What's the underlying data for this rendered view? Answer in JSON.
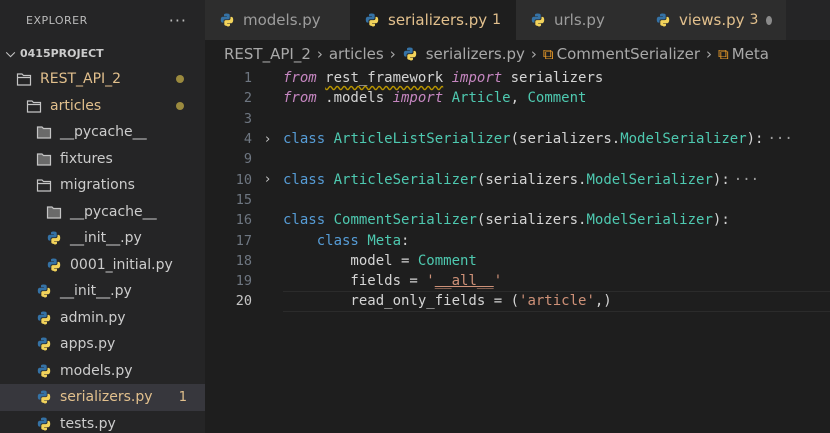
{
  "sidebar": {
    "header": "EXPLORER",
    "more": "···",
    "project": "0415PROJECT",
    "items": [
      {
        "label": "REST_API_2",
        "kind": "folder-open",
        "indent": 1,
        "modified": true,
        "dot": true
      },
      {
        "label": "articles",
        "kind": "folder-open",
        "indent": 2,
        "modified": true,
        "dot": true
      },
      {
        "label": "__pycache__",
        "kind": "folder",
        "indent": 3
      },
      {
        "label": "fixtures",
        "kind": "folder",
        "indent": 3
      },
      {
        "label": "migrations",
        "kind": "folder-open",
        "indent": 3
      },
      {
        "label": "__pycache__",
        "kind": "folder",
        "indent": 4
      },
      {
        "label": "__init__.py",
        "kind": "python",
        "indent": 4
      },
      {
        "label": "0001_initial.py",
        "kind": "python",
        "indent": 4
      },
      {
        "label": "__init__.py",
        "kind": "python",
        "indent": 3
      },
      {
        "label": "admin.py",
        "kind": "python",
        "indent": 3
      },
      {
        "label": "apps.py",
        "kind": "python",
        "indent": 3
      },
      {
        "label": "models.py",
        "kind": "python",
        "indent": 3
      },
      {
        "label": "serializers.py",
        "kind": "python",
        "indent": 3,
        "selected": true,
        "badge": "1"
      },
      {
        "label": "tests.py",
        "kind": "python",
        "indent": 3
      }
    ]
  },
  "tabs": [
    {
      "label": "models.py"
    },
    {
      "label": "serializers.py",
      "active": true,
      "modified": true,
      "count": "1",
      "dot": "white"
    },
    {
      "label": "urls.py"
    },
    {
      "label": "views.py",
      "modified": true,
      "count": "3",
      "dot": "dim"
    }
  ],
  "breadcrumb": [
    "REST_API_2",
    "articles",
    "serializers.py",
    "CommentSerializer",
    "Meta"
  ],
  "editor": {
    "current_line": "20",
    "lines": [
      {
        "n": "1",
        "tokens": [
          [
            "kwi",
            "from"
          ],
          [
            "pl",
            " "
          ],
          [
            "mod",
            "rest_framework"
          ],
          [
            "pl",
            " "
          ],
          [
            "kwi",
            "import"
          ],
          [
            "pl",
            " serializers"
          ]
        ]
      },
      {
        "n": "2",
        "tokens": [
          [
            "kwi",
            "from"
          ],
          [
            "pl",
            " .models "
          ],
          [
            "kwi",
            "import"
          ],
          [
            "pl",
            " "
          ],
          [
            "cls",
            "Article"
          ],
          [
            "pl",
            ", "
          ],
          [
            "cls",
            "Comment"
          ]
        ]
      },
      {
        "n": "3",
        "tokens": []
      },
      {
        "n": "4",
        "fold": true,
        "collapsed": true,
        "tokens": [
          [
            "kw",
            "class"
          ],
          [
            "pl",
            " "
          ],
          [
            "cls",
            "ArticleListSerializer"
          ],
          [
            "pl",
            "(serializers."
          ],
          [
            "cls",
            "ModelSerializer"
          ],
          [
            "pl",
            "):"
          ]
        ]
      },
      {
        "n": "9",
        "tokens": []
      },
      {
        "n": "10",
        "fold": true,
        "collapsed": true,
        "tokens": [
          [
            "kw",
            "class"
          ],
          [
            "pl",
            " "
          ],
          [
            "cls",
            "ArticleSerializer"
          ],
          [
            "pl",
            "(serializers."
          ],
          [
            "cls",
            "ModelSerializer"
          ],
          [
            "pl",
            "):"
          ]
        ]
      },
      {
        "n": "15",
        "tokens": []
      },
      {
        "n": "16",
        "tokens": [
          [
            "kw",
            "class"
          ],
          [
            "pl",
            " "
          ],
          [
            "cls",
            "CommentSerializer"
          ],
          [
            "pl",
            "(serializers."
          ],
          [
            "cls",
            "ModelSerializer"
          ],
          [
            "pl",
            "):"
          ]
        ]
      },
      {
        "n": "17",
        "tokens": [
          [
            "pl",
            "    "
          ],
          [
            "kw",
            "class"
          ],
          [
            "pl",
            " "
          ],
          [
            "cls",
            "Meta"
          ],
          [
            "pl",
            ":"
          ]
        ]
      },
      {
        "n": "18",
        "tokens": [
          [
            "pl",
            "        model = "
          ],
          [
            "cls",
            "Comment"
          ]
        ]
      },
      {
        "n": "19",
        "tokens": [
          [
            "pl",
            "        fields = "
          ],
          [
            "str",
            "'"
          ],
          [
            "str-u",
            "__all__"
          ],
          [
            "str",
            "'"
          ]
        ]
      },
      {
        "n": "20",
        "tokens": [
          [
            "pl",
            "        read_only_fields = ("
          ],
          [
            "str",
            "'article'"
          ],
          [
            "pl",
            ",)"
          ]
        ]
      }
    ],
    "ellipsis": "···",
    "fold_chevron": "›"
  },
  "colors": {
    "modified": "#e2c08d",
    "python_blue": "#3572a5",
    "python_yellow": "#f2d35b",
    "folder": "#c5c5c5"
  }
}
